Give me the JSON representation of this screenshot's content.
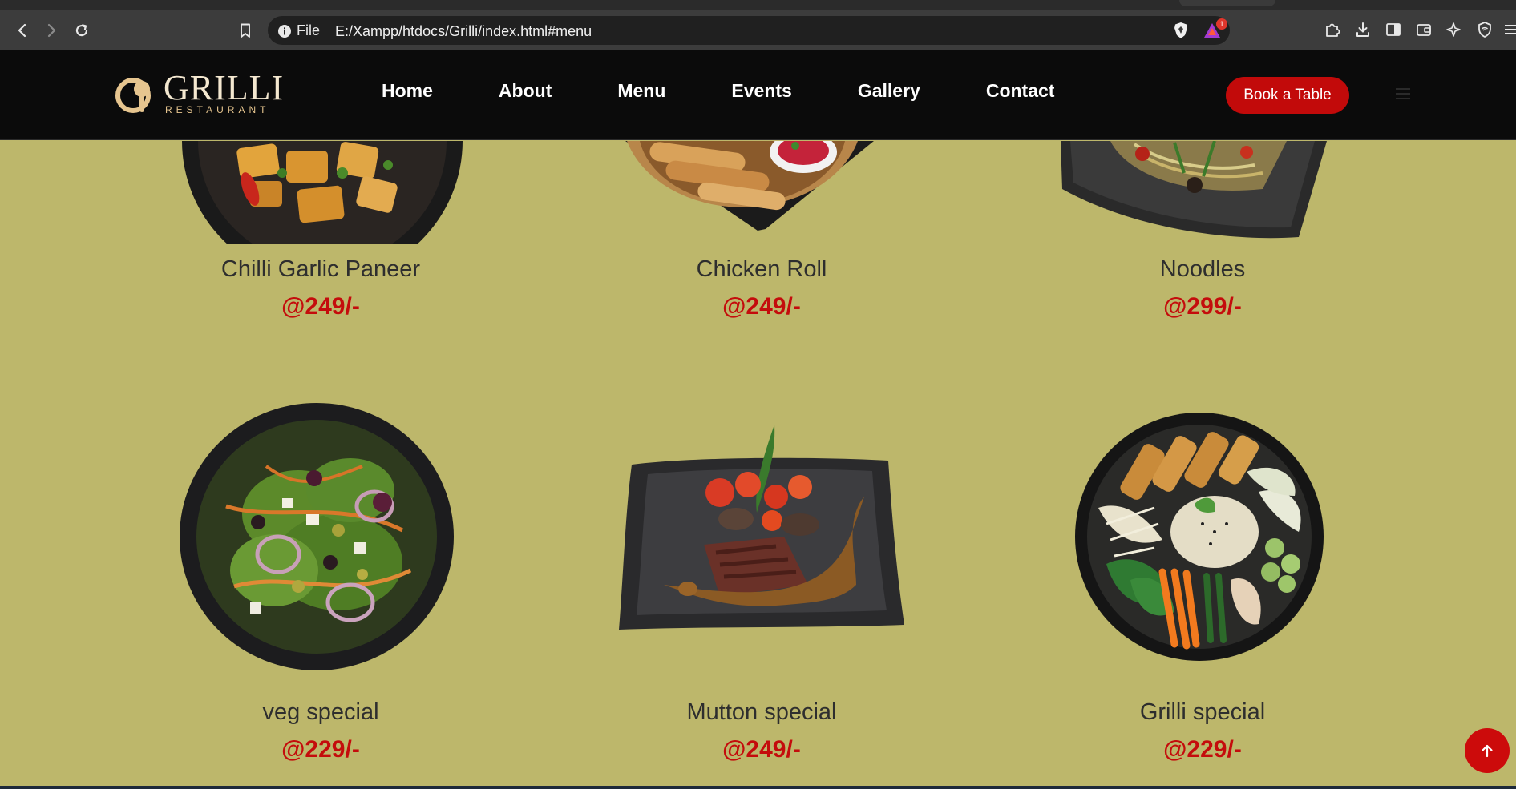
{
  "browser": {
    "address_prefix": "File",
    "url": "E:/Xampp/htdocs/Grilli/index.html#menu",
    "bat_badge": "1"
  },
  "site": {
    "logo_name": "GRILLI",
    "logo_sub": "RESTAURANT",
    "nav": [
      "Home",
      "About",
      "Menu",
      "Events",
      "Gallery",
      "Contact"
    ],
    "book_label": "Book a Table"
  },
  "menu": {
    "items": [
      {
        "name": "Chilli Garlic Paneer",
        "price": "@249/-"
      },
      {
        "name": "Chicken Roll",
        "price": "@249/-"
      },
      {
        "name": "Noodles",
        "price": "@299/-"
      },
      {
        "name": "veg special",
        "price": "@229/-"
      },
      {
        "name": "Mutton special",
        "price": "@249/-"
      },
      {
        "name": "Grilli special",
        "price": "@229/-"
      }
    ]
  },
  "colors": {
    "page_bg": "#bdb76b",
    "header_bg": "#0b0b0b",
    "accent_red": "#c20a0a",
    "logo_gold": "#e6c58f"
  },
  "icons": {
    "back": "chevron-left-icon",
    "forward": "chevron-right-icon",
    "reload": "reload-icon",
    "bookmark": "bookmark-icon",
    "scroll_top": "arrow-up-icon"
  }
}
